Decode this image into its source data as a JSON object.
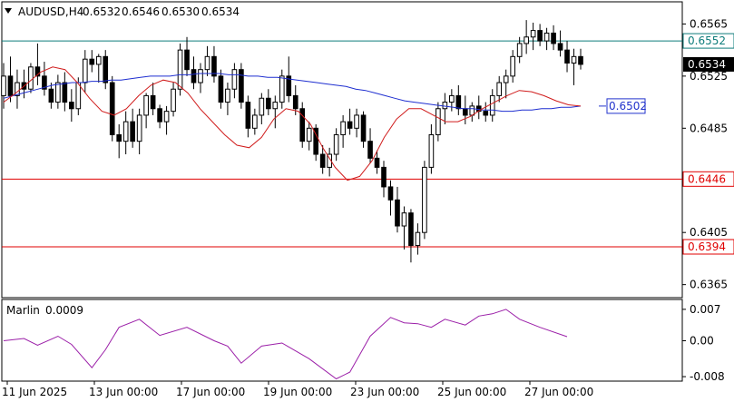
{
  "header": {
    "menu_icon": "triangle-down-icon",
    "symbol": "AUDUSD,H4",
    "ohlc": [
      "0.6532",
      "0.6546",
      "0.6530",
      "0.6534"
    ]
  },
  "indicator": {
    "name": "Marlin",
    "value": "0.0009"
  },
  "chart_data": [
    {
      "type": "candlestick",
      "y_ticks": [
        "0.6565",
        "0.6525",
        "0.6485",
        "0.6445",
        "0.6405",
        "0.6365"
      ],
      "ylim": [
        0.6355,
        0.6582
      ],
      "x_ticks": [
        "11 Jun 2025",
        "13 Jun 00:00",
        "17 Jun 00:00",
        "19 Jun 00:00",
        "23 Jun 00:00",
        "25 Jun 00:00",
        "27 Jun 00:00"
      ],
      "price_labels": [
        {
          "text": "0.6552",
          "value": 0.6552,
          "kind": "level",
          "color": "#0e7c7b"
        },
        {
          "text": "0.6534",
          "value": 0.6534,
          "kind": "current",
          "color": "#000000"
        },
        {
          "text": "0.6446",
          "value": 0.6446,
          "kind": "level",
          "color": "#e00000"
        },
        {
          "text": "0.6394",
          "value": 0.6394,
          "kind": "level",
          "color": "#e00000"
        }
      ],
      "annotation": {
        "text": "0.6502",
        "value": 0.6502,
        "color": "#2233cc"
      },
      "horizontal_levels": [
        {
          "value": 0.6552,
          "color": "#0e7c7b"
        },
        {
          "value": 0.6446,
          "color": "#e00000"
        },
        {
          "value": 0.6394,
          "color": "#e00000"
        }
      ],
      "candles": [
        [
          0.651,
          0.6535,
          0.65,
          0.6525
        ],
        [
          0.6525,
          0.654,
          0.6505,
          0.651
        ],
        [
          0.651,
          0.653,
          0.65,
          0.652
        ],
        [
          0.652,
          0.653,
          0.6508,
          0.6515
        ],
        [
          0.6515,
          0.6535,
          0.6512,
          0.6532
        ],
        [
          0.6532,
          0.655,
          0.6518,
          0.6525
        ],
        [
          0.6525,
          0.6536,
          0.651,
          0.6515
        ],
        [
          0.6515,
          0.652,
          0.65,
          0.6505
        ],
        [
          0.6505,
          0.6526,
          0.65,
          0.652
        ],
        [
          0.652,
          0.6528,
          0.6498,
          0.6505
        ],
        [
          0.6505,
          0.6515,
          0.649,
          0.65
        ],
        [
          0.65,
          0.6524,
          0.6495,
          0.652
        ],
        [
          0.652,
          0.6545,
          0.6512,
          0.6538
        ],
        [
          0.6538,
          0.6545,
          0.6528,
          0.6534
        ],
        [
          0.6534,
          0.6542,
          0.652,
          0.654
        ],
        [
          0.654,
          0.6545,
          0.6515,
          0.652
        ],
        [
          0.652,
          0.6525,
          0.6475,
          0.648
        ],
        [
          0.648,
          0.6488,
          0.6462,
          0.6475
        ],
        [
          0.6475,
          0.6498,
          0.6465,
          0.649
        ],
        [
          0.649,
          0.65,
          0.647,
          0.6475
        ],
        [
          0.6475,
          0.65,
          0.6465,
          0.6495
        ],
        [
          0.6495,
          0.6512,
          0.6485,
          0.651
        ],
        [
          0.651,
          0.652,
          0.6495,
          0.65
        ],
        [
          0.65,
          0.6503,
          0.6485,
          0.649
        ],
        [
          0.649,
          0.6502,
          0.648,
          0.6498
        ],
        [
          0.6498,
          0.652,
          0.6494,
          0.6515
        ],
        [
          0.6515,
          0.655,
          0.651,
          0.6545
        ],
        [
          0.6545,
          0.6555,
          0.6525,
          0.653
        ],
        [
          0.653,
          0.654,
          0.6515,
          0.652
        ],
        [
          0.652,
          0.6535,
          0.6512,
          0.653
        ],
        [
          0.653,
          0.6548,
          0.6525,
          0.654
        ],
        [
          0.654,
          0.6548,
          0.652,
          0.6525
        ],
        [
          0.6525,
          0.653,
          0.65,
          0.6505
        ],
        [
          0.6505,
          0.652,
          0.6495,
          0.6515
        ],
        [
          0.6515,
          0.6535,
          0.6508,
          0.653
        ],
        [
          0.653,
          0.6535,
          0.65,
          0.6505
        ],
        [
          0.6505,
          0.651,
          0.6478,
          0.6485
        ],
        [
          0.6485,
          0.65,
          0.648,
          0.6495
        ],
        [
          0.6495,
          0.6512,
          0.6488,
          0.6508
        ],
        [
          0.6508,
          0.6515,
          0.6495,
          0.65
        ],
        [
          0.65,
          0.651,
          0.6485,
          0.6505
        ],
        [
          0.6505,
          0.653,
          0.65,
          0.6525
        ],
        [
          0.6525,
          0.654,
          0.6505,
          0.651
        ],
        [
          0.651,
          0.6518,
          0.6495,
          0.65
        ],
        [
          0.65,
          0.6505,
          0.647,
          0.6475
        ],
        [
          0.6475,
          0.649,
          0.6468,
          0.6485
        ],
        [
          0.6485,
          0.6488,
          0.646,
          0.6465
        ],
        [
          0.6465,
          0.6472,
          0.645,
          0.6455
        ],
        [
          0.6455,
          0.647,
          0.6448,
          0.6465
        ],
        [
          0.6465,
          0.6485,
          0.646,
          0.648
        ],
        [
          0.648,
          0.6495,
          0.647,
          0.649
        ],
        [
          0.649,
          0.65,
          0.648,
          0.6485
        ],
        [
          0.6485,
          0.65,
          0.6478,
          0.6495
        ],
        [
          0.6495,
          0.6498,
          0.647,
          0.6475
        ],
        [
          0.6475,
          0.6485,
          0.6458,
          0.6462
        ],
        [
          0.6462,
          0.6468,
          0.645,
          0.6455
        ],
        [
          0.6455,
          0.646,
          0.6432,
          0.644
        ],
        [
          0.644,
          0.6445,
          0.6418,
          0.643
        ],
        [
          0.643,
          0.644,
          0.6405,
          0.641
        ],
        [
          0.641,
          0.6425,
          0.6392,
          0.642
        ],
        [
          0.642,
          0.6423,
          0.6382,
          0.6395
        ],
        [
          0.6395,
          0.6412,
          0.6388,
          0.6405
        ],
        [
          0.6405,
          0.646,
          0.64,
          0.6455
        ],
        [
          0.6455,
          0.6488,
          0.645,
          0.648
        ],
        [
          0.648,
          0.6505,
          0.6475,
          0.65
        ],
        [
          0.65,
          0.6512,
          0.6488,
          0.6505
        ],
        [
          0.6505,
          0.6515,
          0.6498,
          0.651
        ],
        [
          0.651,
          0.6518,
          0.6495,
          0.65
        ],
        [
          0.65,
          0.651,
          0.6488,
          0.6495
        ],
        [
          0.6495,
          0.6505,
          0.649,
          0.6502
        ],
        [
          0.6502,
          0.651,
          0.6492,
          0.6498
        ],
        [
          0.6498,
          0.6505,
          0.649,
          0.6495
        ],
        [
          0.6495,
          0.6515,
          0.649,
          0.651
        ],
        [
          0.651,
          0.6525,
          0.6505,
          0.652
        ],
        [
          0.652,
          0.653,
          0.6508,
          0.6525
        ],
        [
          0.6525,
          0.6545,
          0.652,
          0.654
        ],
        [
          0.654,
          0.6555,
          0.6535,
          0.655
        ],
        [
          0.655,
          0.6568,
          0.6542,
          0.6555
        ],
        [
          0.6555,
          0.6566,
          0.6545,
          0.656
        ],
        [
          0.656,
          0.6565,
          0.6548,
          0.6552
        ],
        [
          0.6552,
          0.6562,
          0.6545,
          0.6558
        ],
        [
          0.6558,
          0.6564,
          0.6545,
          0.655
        ],
        [
          0.655,
          0.656,
          0.654,
          0.6545
        ],
        [
          0.6545,
          0.6552,
          0.6528,
          0.6535
        ],
        [
          0.6535,
          0.6546,
          0.6518,
          0.654
        ],
        [
          0.654,
          0.6546,
          0.653,
          0.6534
        ]
      ],
      "series": [
        {
          "values": [
            0.6508,
            0.651,
            0.6512,
            0.6514,
            0.6516,
            0.6518,
            0.6519,
            0.652,
            0.652,
            0.6521,
            0.6521,
            0.6522,
            0.6522,
            0.6523,
            0.6524,
            0.6525,
            0.6525,
            0.6525,
            0.6526,
            0.6526,
            0.6527,
            0.6527,
            0.6527,
            0.6526,
            0.6526,
            0.6525,
            0.6525,
            0.6524,
            0.6524,
            0.6523,
            0.6522,
            0.6521,
            0.652,
            0.6519,
            0.6518,
            0.6517,
            0.6515,
            0.6514,
            0.6512,
            0.651,
            0.6508,
            0.6506,
            0.6505,
            0.6504,
            0.6503,
            0.6502,
            0.6501,
            0.65,
            0.65,
            0.6499,
            0.6499,
            0.6498,
            0.6498,
            0.6499,
            0.6499,
            0.65,
            0.65,
            0.6501,
            0.6501,
            0.6502
          ],
          "color": "#1f2fd0"
        },
        {
          "values": [
            0.6505,
            0.6512,
            0.652,
            0.6528,
            0.6532,
            0.653,
            0.652,
            0.6508,
            0.6498,
            0.6495,
            0.65,
            0.651,
            0.6518,
            0.6522,
            0.652,
            0.6512,
            0.65,
            0.649,
            0.648,
            0.6472,
            0.647,
            0.6478,
            0.6492,
            0.65,
            0.6498,
            0.6488,
            0.647,
            0.6455,
            0.6445,
            0.6448,
            0.646,
            0.6478,
            0.6492,
            0.65,
            0.65,
            0.6495,
            0.649,
            0.649,
            0.6494,
            0.65,
            0.6505,
            0.651,
            0.6514,
            0.6513,
            0.651,
            0.6506,
            0.6503,
            0.6502
          ],
          "color": "#d01c1c"
        }
      ]
    },
    {
      "type": "line",
      "y_ticks": [
        "0.007",
        "0.00",
        "-0.008"
      ],
      "ylim": [
        -0.009,
        0.0092
      ],
      "x": [
        0,
        3,
        5,
        8,
        10,
        13,
        15,
        17,
        20,
        23,
        27,
        31,
        33,
        35,
        38,
        41,
        45,
        49,
        51,
        54,
        57,
        59,
        61,
        63,
        65,
        68,
        70,
        72,
        74,
        76,
        79,
        83
      ],
      "series": [
        {
          "name": "Marlin",
          "color": "#9b1fa8",
          "values": [
            0.0,
            0.0005,
            -0.001,
            0.001,
            -0.0008,
            -0.006,
            -0.002,
            0.003,
            0.0048,
            0.0012,
            0.003,
            0.0,
            -0.0012,
            -0.005,
            -0.0012,
            -0.0005,
            -0.004,
            -0.0085,
            -0.007,
            0.001,
            0.0052,
            0.004,
            0.0038,
            0.003,
            0.0048,
            0.0035,
            0.0055,
            0.006,
            0.007,
            0.0048,
            0.003,
            0.0009
          ]
        }
      ]
    }
  ]
}
